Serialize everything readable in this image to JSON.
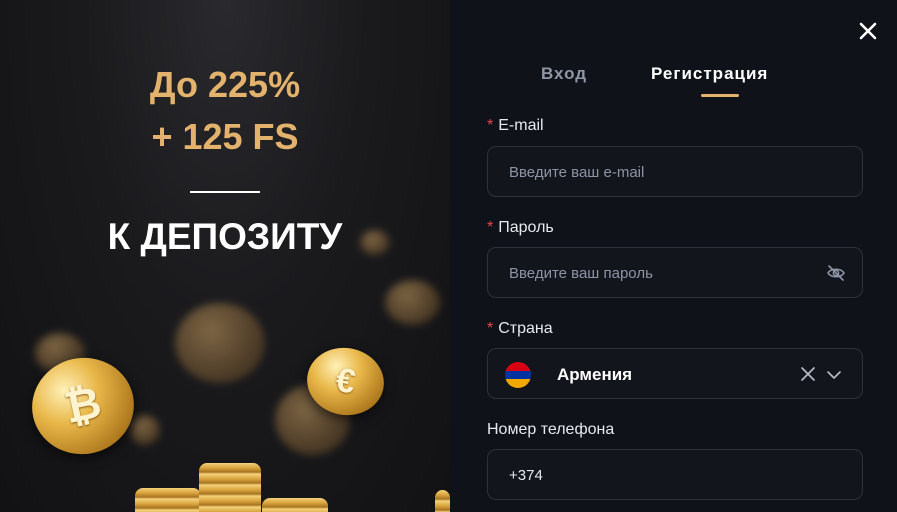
{
  "promo": {
    "line1": "До 225%",
    "line2": "+ 125 FS",
    "line3": "К ДЕПОЗИТУ"
  },
  "coins": {
    "bitcoin_symbol": "₿",
    "euro_symbol": "€"
  },
  "tabs": {
    "login": "Вход",
    "register": "Регистрация"
  },
  "form": {
    "required_mark": "*",
    "email": {
      "label": "E-mail",
      "placeholder": "Введите ваш e-mail",
      "value": ""
    },
    "password": {
      "label": "Пароль",
      "placeholder": "Введите ваш пароль",
      "value": ""
    },
    "country": {
      "label": "Страна",
      "value": "Армения"
    },
    "phone": {
      "label": "Номер телефона",
      "value": "+374"
    }
  },
  "icons": {
    "close": "close-icon",
    "eye": "eye-off-icon",
    "clear": "clear-icon",
    "chevron": "chevron-down-icon",
    "flag": "armenia-flag-icon"
  },
  "colors": {
    "accent": "#e3b36d",
    "required": "#e5484d",
    "background": "#0f1218"
  }
}
